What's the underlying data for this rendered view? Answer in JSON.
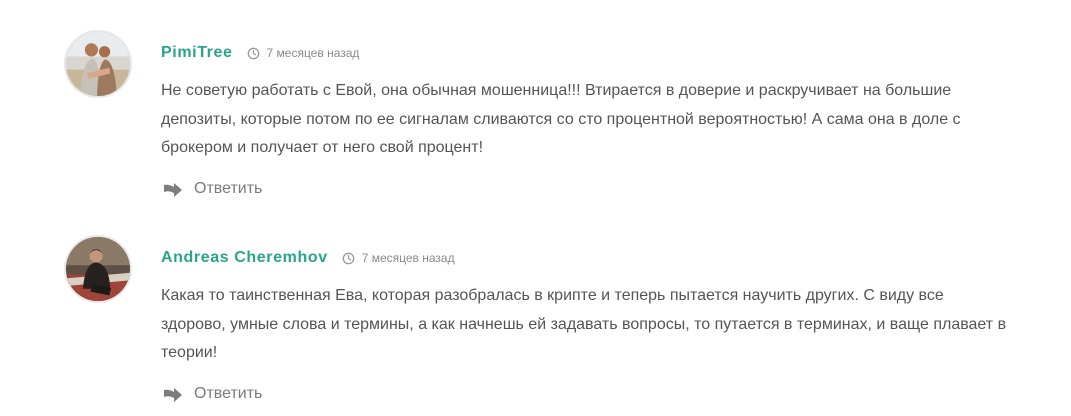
{
  "comments": [
    {
      "author": "PimiTree",
      "time": "7 месяцев назад",
      "text": "Не советую работать с Евой, она обычная мошенница!!! Втирается в доверие и раскручивает на большие депозиты, которые потом по ее сигналам сливаются со сто процентной вероятностью! А сама она в доле с брокером и получает от него свой процент!",
      "reply_label": "Ответить"
    },
    {
      "author": "Andreas Cheremhov",
      "time": "7 месяцев назад",
      "text": "Какая то таинственная Ева, которая разобралась в крипте и теперь пытается научить других. С виду все здорово, умные слова и термины, а как начнешь ей задавать вопросы, то путается в терминах, и ваще плавает в теории!",
      "reply_label": "Ответить"
    }
  ],
  "colors": {
    "author": "#2aa58a",
    "text": "#555555",
    "meta": "#8a8a8a"
  },
  "icons": {
    "time": "clock-icon",
    "reply": "reply-arrow-icon"
  }
}
